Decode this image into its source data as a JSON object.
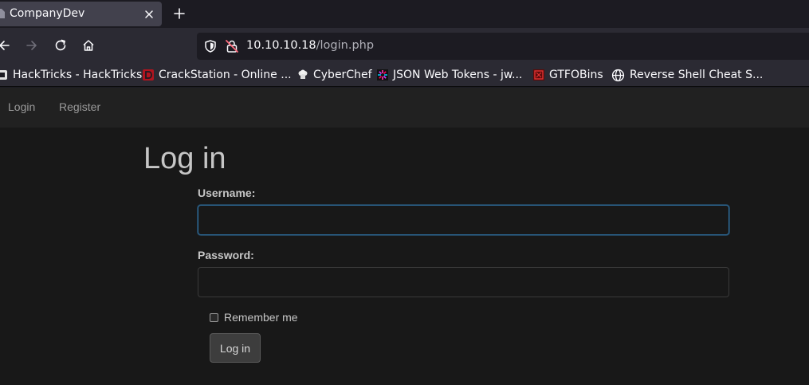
{
  "browser": {
    "tab": {
      "title": "CompanyDev",
      "favicon": "page-icon"
    },
    "new_tab_icon": "plus-icon",
    "nav": {
      "back": "arrow-left-icon",
      "forward": "arrow-right-icon",
      "reload": "reload-icon",
      "home": "home-icon"
    },
    "url": {
      "host": "10.10.10.18",
      "path": "/login.php"
    },
    "bookmarks": [
      {
        "label": "HackTricks - HackTricks",
        "icon": "hacktricks-icon"
      },
      {
        "label": "CrackStation - Online ...",
        "icon": "crackstation-icon"
      },
      {
        "label": "CyberChef",
        "icon": "cyberchef-icon"
      },
      {
        "label": "JSON Web Tokens - jw...",
        "icon": "jwt-icon"
      },
      {
        "label": "GTFOBins",
        "icon": "gtfobins-icon"
      },
      {
        "label": "Reverse Shell Cheat S...",
        "icon": "globe-icon"
      }
    ]
  },
  "site": {
    "nav": {
      "login": "Login",
      "register": "Register"
    },
    "title": "Log in",
    "form": {
      "username_label": "Username:",
      "username_value": "",
      "password_label": "Password:",
      "password_value": "",
      "remember_label": "Remember me",
      "remember_checked": false,
      "submit_label": "Log in"
    }
  },
  "colors": {
    "focus_ring": "#2e6fa0",
    "page_bg": "#181818",
    "nav_bg": "#212121"
  }
}
